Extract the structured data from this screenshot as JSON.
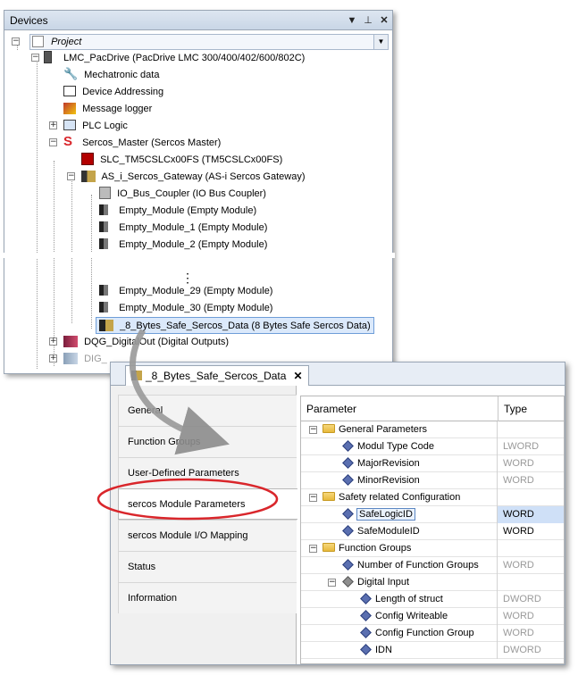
{
  "devices": {
    "title": "Devices",
    "project": "Project",
    "tree": [
      {
        "label": "LMC_PacDrive (PacDrive LMC 300/400/402/600/802C)",
        "icon": "controller-icon"
      },
      {
        "label": "Mechatronic data",
        "icon": "wrench-icon"
      },
      {
        "label": "Device Addressing",
        "icon": "addressing-icon"
      },
      {
        "label": "Message logger",
        "icon": "logger-icon"
      },
      {
        "label": "PLC Logic",
        "icon": "plc-logic-icon"
      },
      {
        "label": "Sercos_Master (Sercos Master)",
        "icon": "sercos-s-icon"
      },
      {
        "label": "SLC_TM5CSLCx00FS (TM5CSLCx00FS)",
        "icon": "safety-controller-icon"
      },
      {
        "label": "AS_i_Sercos_Gateway (AS-i Sercos Gateway)",
        "icon": "gateway-icon"
      },
      {
        "label": "IO_Bus_Coupler (IO Bus Coupler)",
        "icon": "coupler-icon"
      },
      {
        "label": "Empty_Module (Empty Module)",
        "icon": "module-icon"
      },
      {
        "label": "Empty_Module_1 (Empty Module)",
        "icon": "module-icon"
      },
      {
        "label": "Empty_Module_2 (Empty Module)",
        "icon": "module-icon"
      },
      {
        "label": "⋮",
        "icon": ""
      },
      {
        "label": "Empty_Module_29 (Empty Module)",
        "icon": "module-icon"
      },
      {
        "label": "Empty_Module_30 (Empty Module)",
        "icon": "module-icon"
      },
      {
        "label": "_8_Bytes_Safe_Sercos_Data (8 Bytes Safe Sercos Data)",
        "icon": "safe-data-icon"
      },
      {
        "label": "DQG_DigitalOut (Digital Outputs)",
        "icon": "digital-out-icon"
      },
      {
        "label": "DIG_",
        "icon": "digital-in-icon"
      }
    ]
  },
  "editor": {
    "tab_label": "_8_Bytes_Safe_Sercos_Data",
    "nav": [
      "General",
      "Function Groups",
      "User-Defined Parameters",
      "sercos Module Parameters",
      "sercos Module I/O Mapping",
      "Status",
      "Information"
    ],
    "grid": {
      "col_parameter": "Parameter",
      "col_type": "Type",
      "rows": [
        {
          "name": "General Parameters",
          "type": ""
        },
        {
          "name": "Modul Type Code",
          "type": "LWORD"
        },
        {
          "name": "MajorRevision",
          "type": "WORD"
        },
        {
          "name": "MinorRevision",
          "type": "WORD"
        },
        {
          "name": "Safety related Configuration",
          "type": ""
        },
        {
          "name": "SafeLogicID",
          "type": "WORD"
        },
        {
          "name": "SafeModuleID",
          "type": "WORD"
        },
        {
          "name": "Function Groups",
          "type": ""
        },
        {
          "name": "Number of Function Groups",
          "type": "WORD"
        },
        {
          "name": "Digital Input",
          "type": ""
        },
        {
          "name": "Length of struct",
          "type": "DWORD"
        },
        {
          "name": "Config Writeable",
          "type": "WORD"
        },
        {
          "name": "Config Function Group",
          "type": "WORD"
        },
        {
          "name": "IDN",
          "type": "DWORD"
        }
      ]
    }
  },
  "colors": {
    "highlight_ellipse": "#d9262b",
    "selection": "#cfe0f7",
    "panel_border": "#9aa6b5"
  }
}
